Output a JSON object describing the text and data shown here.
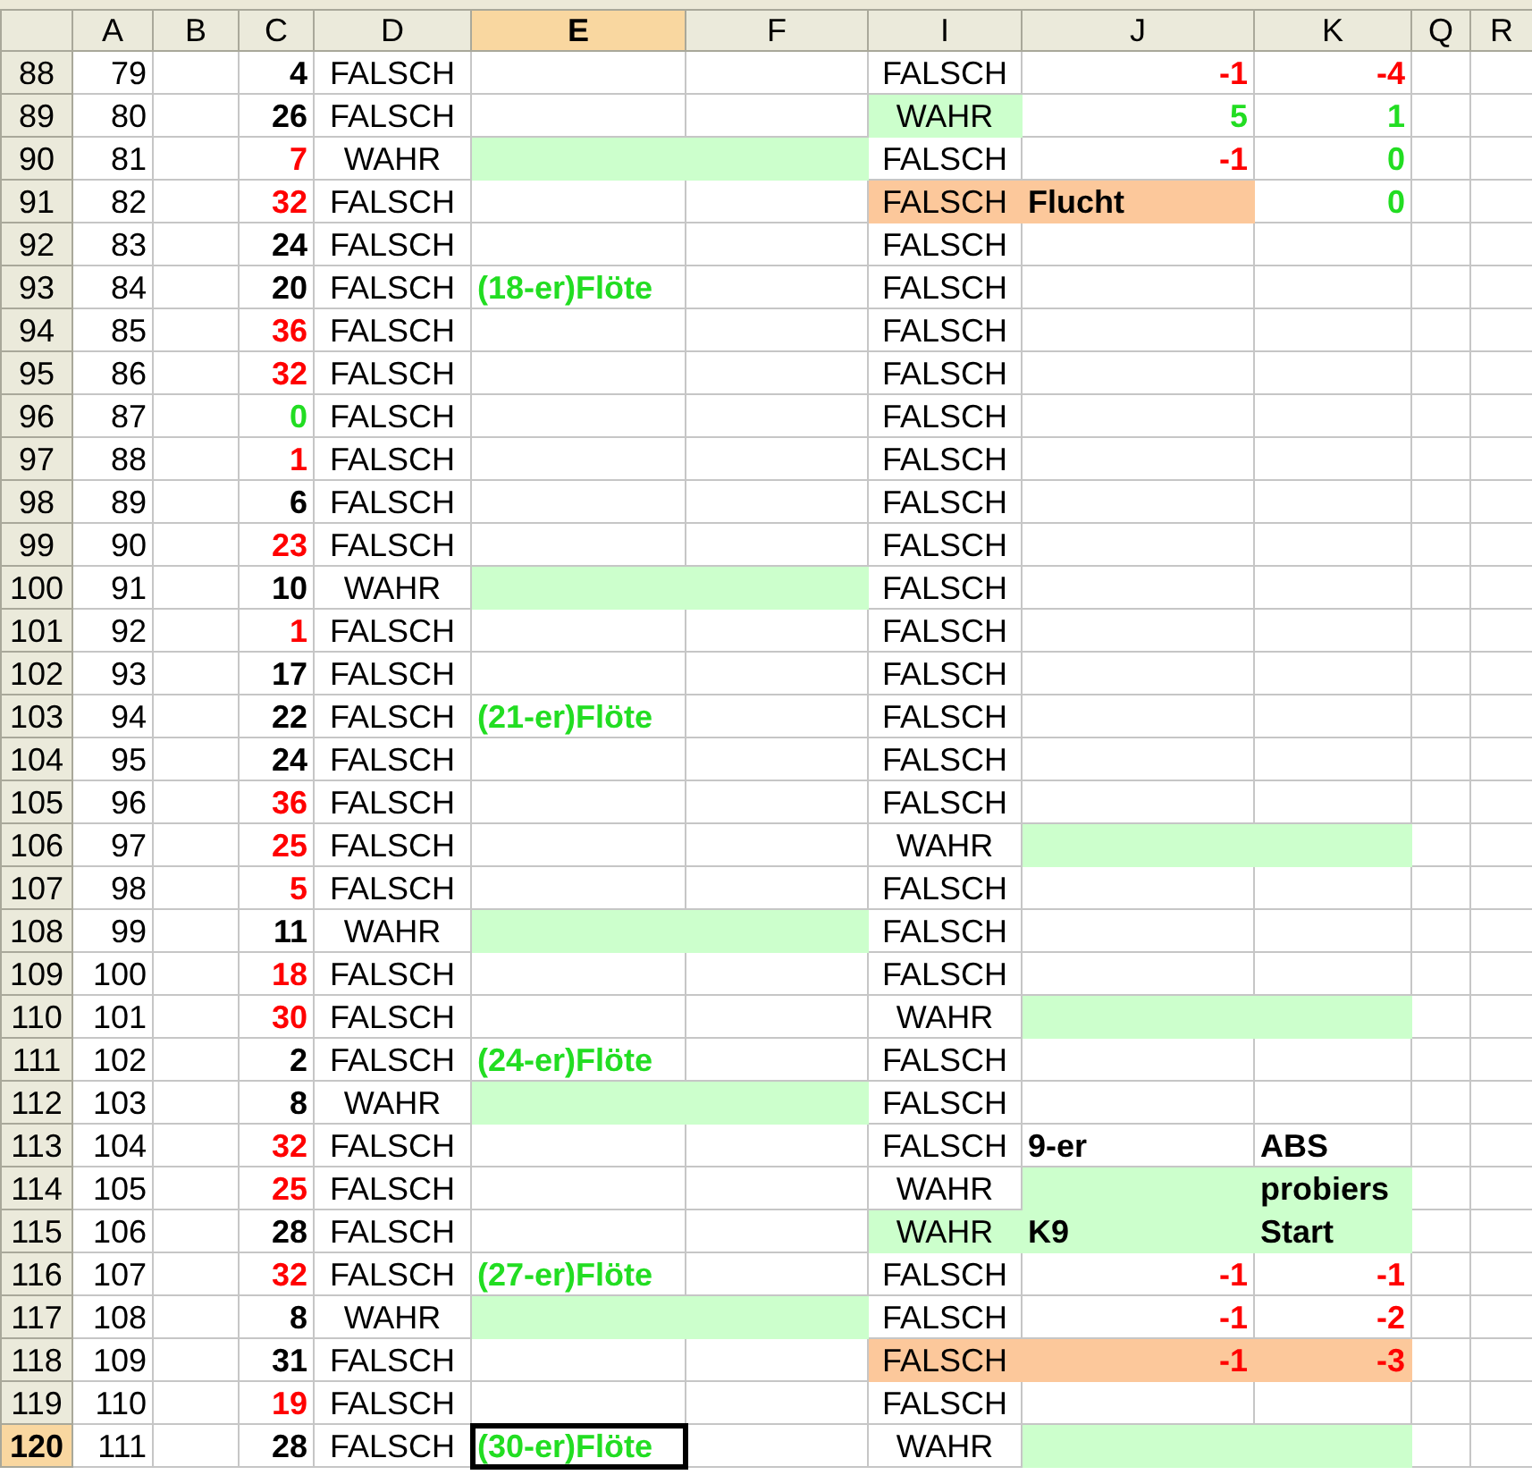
{
  "columns": [
    {
      "label": "A",
      "selected": false
    },
    {
      "label": "B",
      "selected": false
    },
    {
      "label": "C",
      "selected": false
    },
    {
      "label": "D",
      "selected": false
    },
    {
      "label": "E",
      "selected": true
    },
    {
      "label": "F",
      "selected": false
    },
    {
      "label": "I",
      "selected": false
    },
    {
      "label": "J",
      "selected": false
    },
    {
      "label": "K",
      "selected": false
    },
    {
      "label": "Q",
      "selected": false
    },
    {
      "label": "R",
      "selected": false
    }
  ],
  "rows": [
    {
      "header": "88",
      "selected": false,
      "cells": {
        "A": {
          "kind": "num",
          "text": "79"
        },
        "C": {
          "kind": "bnum",
          "text": "4"
        },
        "D": {
          "kind": "bool",
          "text": "FALSCH"
        },
        "I": {
          "kind": "bool",
          "text": "FALSCH"
        },
        "J": {
          "kind": "bnum",
          "text": "-1",
          "color": "#ff0000"
        },
        "K": {
          "kind": "bnum",
          "text": "-4",
          "color": "#ff0000"
        }
      }
    },
    {
      "header": "89",
      "selected": false,
      "cells": {
        "A": {
          "kind": "num",
          "text": "80"
        },
        "C": {
          "kind": "bnum",
          "text": "26"
        },
        "D": {
          "kind": "bool",
          "text": "FALSCH"
        },
        "I": {
          "kind": "bool",
          "text": "WAHR",
          "highlight": {
            "color": "#ccffcc"
          }
        },
        "J": {
          "kind": "bnum",
          "text": "5",
          "color": "#22dd22"
        },
        "K": {
          "kind": "bnum",
          "text": "1",
          "color": "#22dd22"
        }
      }
    },
    {
      "header": "90",
      "selected": false,
      "cells": {
        "A": {
          "kind": "num",
          "text": "81"
        },
        "C": {
          "kind": "bnum",
          "text": "7",
          "color": "#ff0000"
        },
        "D": {
          "kind": "bool",
          "text": "WAHR"
        },
        "E": {
          "highlight": {
            "color": "#ccffcc"
          }
        },
        "F": {
          "highlight": {
            "color": "#ccffcc"
          }
        },
        "I": {
          "kind": "bool",
          "text": "FALSCH"
        },
        "J": {
          "kind": "bnum",
          "text": "-1",
          "color": "#ff0000"
        },
        "K": {
          "kind": "bnum",
          "text": "0",
          "color": "#22dd22"
        }
      }
    },
    {
      "header": "91",
      "selected": false,
      "cells": {
        "A": {
          "kind": "num",
          "text": "82"
        },
        "C": {
          "kind": "bnum",
          "text": "32",
          "color": "#ff0000"
        },
        "D": {
          "kind": "bool",
          "text": "FALSCH"
        },
        "I": {
          "kind": "bool",
          "text": "FALSCH",
          "highlight": {
            "color": "#fcc89b"
          }
        },
        "J": {
          "kind": "label",
          "text": "Flucht",
          "highlight": {
            "color": "#fcc89b"
          }
        },
        "K": {
          "kind": "bnum",
          "text": "0",
          "color": "#22dd22"
        }
      }
    },
    {
      "header": "92",
      "selected": false,
      "cells": {
        "A": {
          "kind": "num",
          "text": "83"
        },
        "C": {
          "kind": "bnum",
          "text": "24"
        },
        "D": {
          "kind": "bool",
          "text": "FALSCH"
        },
        "I": {
          "kind": "bool",
          "text": "FALSCH"
        }
      }
    },
    {
      "header": "93",
      "selected": false,
      "cells": {
        "A": {
          "kind": "num",
          "text": "84"
        },
        "C": {
          "kind": "bnum",
          "text": "20"
        },
        "D": {
          "kind": "bool",
          "text": "FALSCH"
        },
        "E": {
          "kind": "label",
          "text": "(18-er)Flöte",
          "color": "#22dd22"
        },
        "I": {
          "kind": "bool",
          "text": "FALSCH"
        }
      }
    },
    {
      "header": "94",
      "selected": false,
      "cells": {
        "A": {
          "kind": "num",
          "text": "85"
        },
        "C": {
          "kind": "bnum",
          "text": "36",
          "color": "#ff0000"
        },
        "D": {
          "kind": "bool",
          "text": "FALSCH"
        },
        "I": {
          "kind": "bool",
          "text": "FALSCH"
        }
      }
    },
    {
      "header": "95",
      "selected": false,
      "cells": {
        "A": {
          "kind": "num",
          "text": "86"
        },
        "C": {
          "kind": "bnum",
          "text": "32",
          "color": "#ff0000"
        },
        "D": {
          "kind": "bool",
          "text": "FALSCH"
        },
        "I": {
          "kind": "bool",
          "text": "FALSCH"
        }
      }
    },
    {
      "header": "96",
      "selected": false,
      "cells": {
        "A": {
          "kind": "num",
          "text": "87"
        },
        "C": {
          "kind": "bnum",
          "text": "0",
          "color": "#22dd22"
        },
        "D": {
          "kind": "bool",
          "text": "FALSCH"
        },
        "I": {
          "kind": "bool",
          "text": "FALSCH"
        }
      }
    },
    {
      "header": "97",
      "selected": false,
      "cells": {
        "A": {
          "kind": "num",
          "text": "88"
        },
        "C": {
          "kind": "bnum",
          "text": "1",
          "color": "#ff0000"
        },
        "D": {
          "kind": "bool",
          "text": "FALSCH"
        },
        "I": {
          "kind": "bool",
          "text": "FALSCH"
        }
      }
    },
    {
      "header": "98",
      "selected": false,
      "cells": {
        "A": {
          "kind": "num",
          "text": "89"
        },
        "C": {
          "kind": "bnum",
          "text": "6"
        },
        "D": {
          "kind": "bool",
          "text": "FALSCH"
        },
        "I": {
          "kind": "bool",
          "text": "FALSCH"
        }
      }
    },
    {
      "header": "99",
      "selected": false,
      "cells": {
        "A": {
          "kind": "num",
          "text": "90"
        },
        "C": {
          "kind": "bnum",
          "text": "23",
          "color": "#ff0000"
        },
        "D": {
          "kind": "bool",
          "text": "FALSCH"
        },
        "I": {
          "kind": "bool",
          "text": "FALSCH"
        }
      }
    },
    {
      "header": "100",
      "selected": false,
      "cells": {
        "A": {
          "kind": "num",
          "text": "91"
        },
        "C": {
          "kind": "bnum",
          "text": "10"
        },
        "D": {
          "kind": "bool",
          "text": "WAHR"
        },
        "E": {
          "highlight": {
            "color": "#ccffcc"
          }
        },
        "F": {
          "highlight": {
            "color": "#ccffcc"
          }
        },
        "I": {
          "kind": "bool",
          "text": "FALSCH"
        }
      }
    },
    {
      "header": "101",
      "selected": false,
      "cells": {
        "A": {
          "kind": "num",
          "text": "92"
        },
        "C": {
          "kind": "bnum",
          "text": "1",
          "color": "#ff0000"
        },
        "D": {
          "kind": "bool",
          "text": "FALSCH"
        },
        "I": {
          "kind": "bool",
          "text": "FALSCH"
        }
      }
    },
    {
      "header": "102",
      "selected": false,
      "cells": {
        "A": {
          "kind": "num",
          "text": "93"
        },
        "C": {
          "kind": "bnum",
          "text": "17"
        },
        "D": {
          "kind": "bool",
          "text": "FALSCH"
        },
        "I": {
          "kind": "bool",
          "text": "FALSCH"
        }
      }
    },
    {
      "header": "103",
      "selected": false,
      "cells": {
        "A": {
          "kind": "num",
          "text": "94"
        },
        "C": {
          "kind": "bnum",
          "text": "22"
        },
        "D": {
          "kind": "bool",
          "text": "FALSCH"
        },
        "E": {
          "kind": "label",
          "text": "(21-er)Flöte",
          "color": "#22dd22"
        },
        "I": {
          "kind": "bool",
          "text": "FALSCH"
        }
      }
    },
    {
      "header": "104",
      "selected": false,
      "cells": {
        "A": {
          "kind": "num",
          "text": "95"
        },
        "C": {
          "kind": "bnum",
          "text": "24"
        },
        "D": {
          "kind": "bool",
          "text": "FALSCH"
        },
        "I": {
          "kind": "bool",
          "text": "FALSCH"
        }
      }
    },
    {
      "header": "105",
      "selected": false,
      "cells": {
        "A": {
          "kind": "num",
          "text": "96"
        },
        "C": {
          "kind": "bnum",
          "text": "36",
          "color": "#ff0000"
        },
        "D": {
          "kind": "bool",
          "text": "FALSCH"
        },
        "I": {
          "kind": "bool",
          "text": "FALSCH"
        }
      }
    },
    {
      "header": "106",
      "selected": false,
      "cells": {
        "A": {
          "kind": "num",
          "text": "97"
        },
        "C": {
          "kind": "bnum",
          "text": "25",
          "color": "#ff0000"
        },
        "D": {
          "kind": "bool",
          "text": "FALSCH"
        },
        "I": {
          "kind": "bool",
          "text": "WAHR"
        },
        "J": {
          "highlight": {
            "color": "#ccffcc"
          }
        },
        "K": {
          "highlight": {
            "color": "#ccffcc"
          }
        }
      }
    },
    {
      "header": "107",
      "selected": false,
      "cells": {
        "A": {
          "kind": "num",
          "text": "98"
        },
        "C": {
          "kind": "bnum",
          "text": "5",
          "color": "#ff0000"
        },
        "D": {
          "kind": "bool",
          "text": "FALSCH"
        },
        "I": {
          "kind": "bool",
          "text": "FALSCH"
        }
      }
    },
    {
      "header": "108",
      "selected": false,
      "cells": {
        "A": {
          "kind": "num",
          "text": "99"
        },
        "C": {
          "kind": "bnum",
          "text": "11"
        },
        "D": {
          "kind": "bool",
          "text": "WAHR"
        },
        "E": {
          "highlight": {
            "color": "#ccffcc"
          }
        },
        "F": {
          "highlight": {
            "color": "#ccffcc"
          }
        },
        "I": {
          "kind": "bool",
          "text": "FALSCH"
        }
      }
    },
    {
      "header": "109",
      "selected": false,
      "cells": {
        "A": {
          "kind": "num",
          "text": "100"
        },
        "C": {
          "kind": "bnum",
          "text": "18",
          "color": "#ff0000"
        },
        "D": {
          "kind": "bool",
          "text": "FALSCH"
        },
        "I": {
          "kind": "bool",
          "text": "FALSCH"
        }
      }
    },
    {
      "header": "110",
      "selected": false,
      "cells": {
        "A": {
          "kind": "num",
          "text": "101"
        },
        "C": {
          "kind": "bnum",
          "text": "30",
          "color": "#ff0000"
        },
        "D": {
          "kind": "bool",
          "text": "FALSCH"
        },
        "I": {
          "kind": "bool",
          "text": "WAHR"
        },
        "J": {
          "highlight": {
            "color": "#ccffcc"
          }
        },
        "K": {
          "highlight": {
            "color": "#ccffcc"
          }
        }
      }
    },
    {
      "header": "111",
      "selected": false,
      "cells": {
        "A": {
          "kind": "num",
          "text": "102"
        },
        "C": {
          "kind": "bnum",
          "text": "2"
        },
        "D": {
          "kind": "bool",
          "text": "FALSCH"
        },
        "E": {
          "kind": "label",
          "text": "(24-er)Flöte",
          "color": "#22dd22"
        },
        "I": {
          "kind": "bool",
          "text": "FALSCH"
        }
      }
    },
    {
      "header": "112",
      "selected": false,
      "cells": {
        "A": {
          "kind": "num",
          "text": "103"
        },
        "C": {
          "kind": "bnum",
          "text": "8"
        },
        "D": {
          "kind": "bool",
          "text": "WAHR"
        },
        "E": {
          "highlight": {
            "color": "#ccffcc"
          }
        },
        "F": {
          "highlight": {
            "color": "#ccffcc"
          }
        },
        "I": {
          "kind": "bool",
          "text": "FALSCH"
        }
      }
    },
    {
      "header": "113",
      "selected": false,
      "cells": {
        "A": {
          "kind": "num",
          "text": "104"
        },
        "C": {
          "kind": "bnum",
          "text": "32",
          "color": "#ff0000"
        },
        "D": {
          "kind": "bool",
          "text": "FALSCH"
        },
        "I": {
          "kind": "bool",
          "text": "FALSCH"
        },
        "J": {
          "kind": "label",
          "text": "9-er"
        },
        "K": {
          "kind": "label",
          "text": "ABS"
        }
      }
    },
    {
      "header": "114",
      "selected": false,
      "cells": {
        "A": {
          "kind": "num",
          "text": "105"
        },
        "C": {
          "kind": "bnum",
          "text": "25",
          "color": "#ff0000"
        },
        "D": {
          "kind": "bool",
          "text": "FALSCH"
        },
        "I": {
          "kind": "bool",
          "text": "WAHR"
        },
        "J": {
          "highlight": {
            "color": "#ccffcc"
          }
        },
        "K": {
          "kind": "label",
          "text": "probiers",
          "highlight": {
            "color": "#ccffcc"
          }
        }
      }
    },
    {
      "header": "115",
      "selected": false,
      "cells": {
        "A": {
          "kind": "num",
          "text": "106"
        },
        "C": {
          "kind": "bnum",
          "text": "28"
        },
        "D": {
          "kind": "bool",
          "text": "FALSCH"
        },
        "I": {
          "kind": "bool",
          "text": "WAHR",
          "highlight": {
            "color": "#ccffcc"
          }
        },
        "J": {
          "kind": "label",
          "text": "K9",
          "highlight": {
            "color": "#ccffcc"
          }
        },
        "K": {
          "kind": "label",
          "text": "Start",
          "highlight": {
            "color": "#ccffcc"
          }
        }
      }
    },
    {
      "header": "116",
      "selected": false,
      "cells": {
        "A": {
          "kind": "num",
          "text": "107"
        },
        "C": {
          "kind": "bnum",
          "text": "32",
          "color": "#ff0000"
        },
        "D": {
          "kind": "bool",
          "text": "FALSCH"
        },
        "E": {
          "kind": "label",
          "text": "(27-er)Flöte",
          "color": "#22dd22"
        },
        "I": {
          "kind": "bool",
          "text": "FALSCH"
        },
        "J": {
          "kind": "bnum",
          "text": "-1",
          "color": "#ff0000"
        },
        "K": {
          "kind": "bnum",
          "text": "-1",
          "color": "#ff0000"
        }
      }
    },
    {
      "header": "117",
      "selected": false,
      "cells": {
        "A": {
          "kind": "num",
          "text": "108"
        },
        "C": {
          "kind": "bnum",
          "text": "8"
        },
        "D": {
          "kind": "bool",
          "text": "WAHR"
        },
        "E": {
          "highlight": {
            "color": "#ccffcc"
          }
        },
        "F": {
          "highlight": {
            "color": "#ccffcc"
          }
        },
        "I": {
          "kind": "bool",
          "text": "FALSCH"
        },
        "J": {
          "kind": "bnum",
          "text": "-1",
          "color": "#ff0000"
        },
        "K": {
          "kind": "bnum",
          "text": "-2",
          "color": "#ff0000"
        }
      }
    },
    {
      "header": "118",
      "selected": false,
      "cells": {
        "A": {
          "kind": "num",
          "text": "109"
        },
        "C": {
          "kind": "bnum",
          "text": "31"
        },
        "D": {
          "kind": "bool",
          "text": "FALSCH"
        },
        "I": {
          "kind": "bool",
          "text": "FALSCH",
          "highlight": {
            "color": "#fcc89b"
          }
        },
        "J": {
          "kind": "bnum",
          "text": "-1",
          "color": "#ff0000",
          "highlight": {
            "color": "#fcc89b"
          }
        },
        "K": {
          "kind": "bnum",
          "text": "-3",
          "color": "#ff0000",
          "highlight": {
            "color": "#fcc89b"
          }
        }
      }
    },
    {
      "header": "119",
      "selected": false,
      "cells": {
        "A": {
          "kind": "num",
          "text": "110"
        },
        "C": {
          "kind": "bnum",
          "text": "19",
          "color": "#ff0000"
        },
        "D": {
          "kind": "bool",
          "text": "FALSCH"
        },
        "I": {
          "kind": "bool",
          "text": "FALSCH"
        }
      }
    },
    {
      "header": "120",
      "selected": true,
      "cells": {
        "A": {
          "kind": "num",
          "text": "111"
        },
        "C": {
          "kind": "bnum",
          "text": "28"
        },
        "D": {
          "kind": "bool",
          "text": "FALSCH"
        },
        "E": {
          "kind": "label",
          "text": "(30-er)Flöte",
          "color": "#22dd22"
        },
        "I": {
          "kind": "bool",
          "text": "WAHR"
        },
        "J": {
          "highlight": {
            "color": "#ccffcc"
          }
        },
        "K": {
          "highlight": {
            "color": "#ccffcc"
          }
        }
      }
    }
  ]
}
